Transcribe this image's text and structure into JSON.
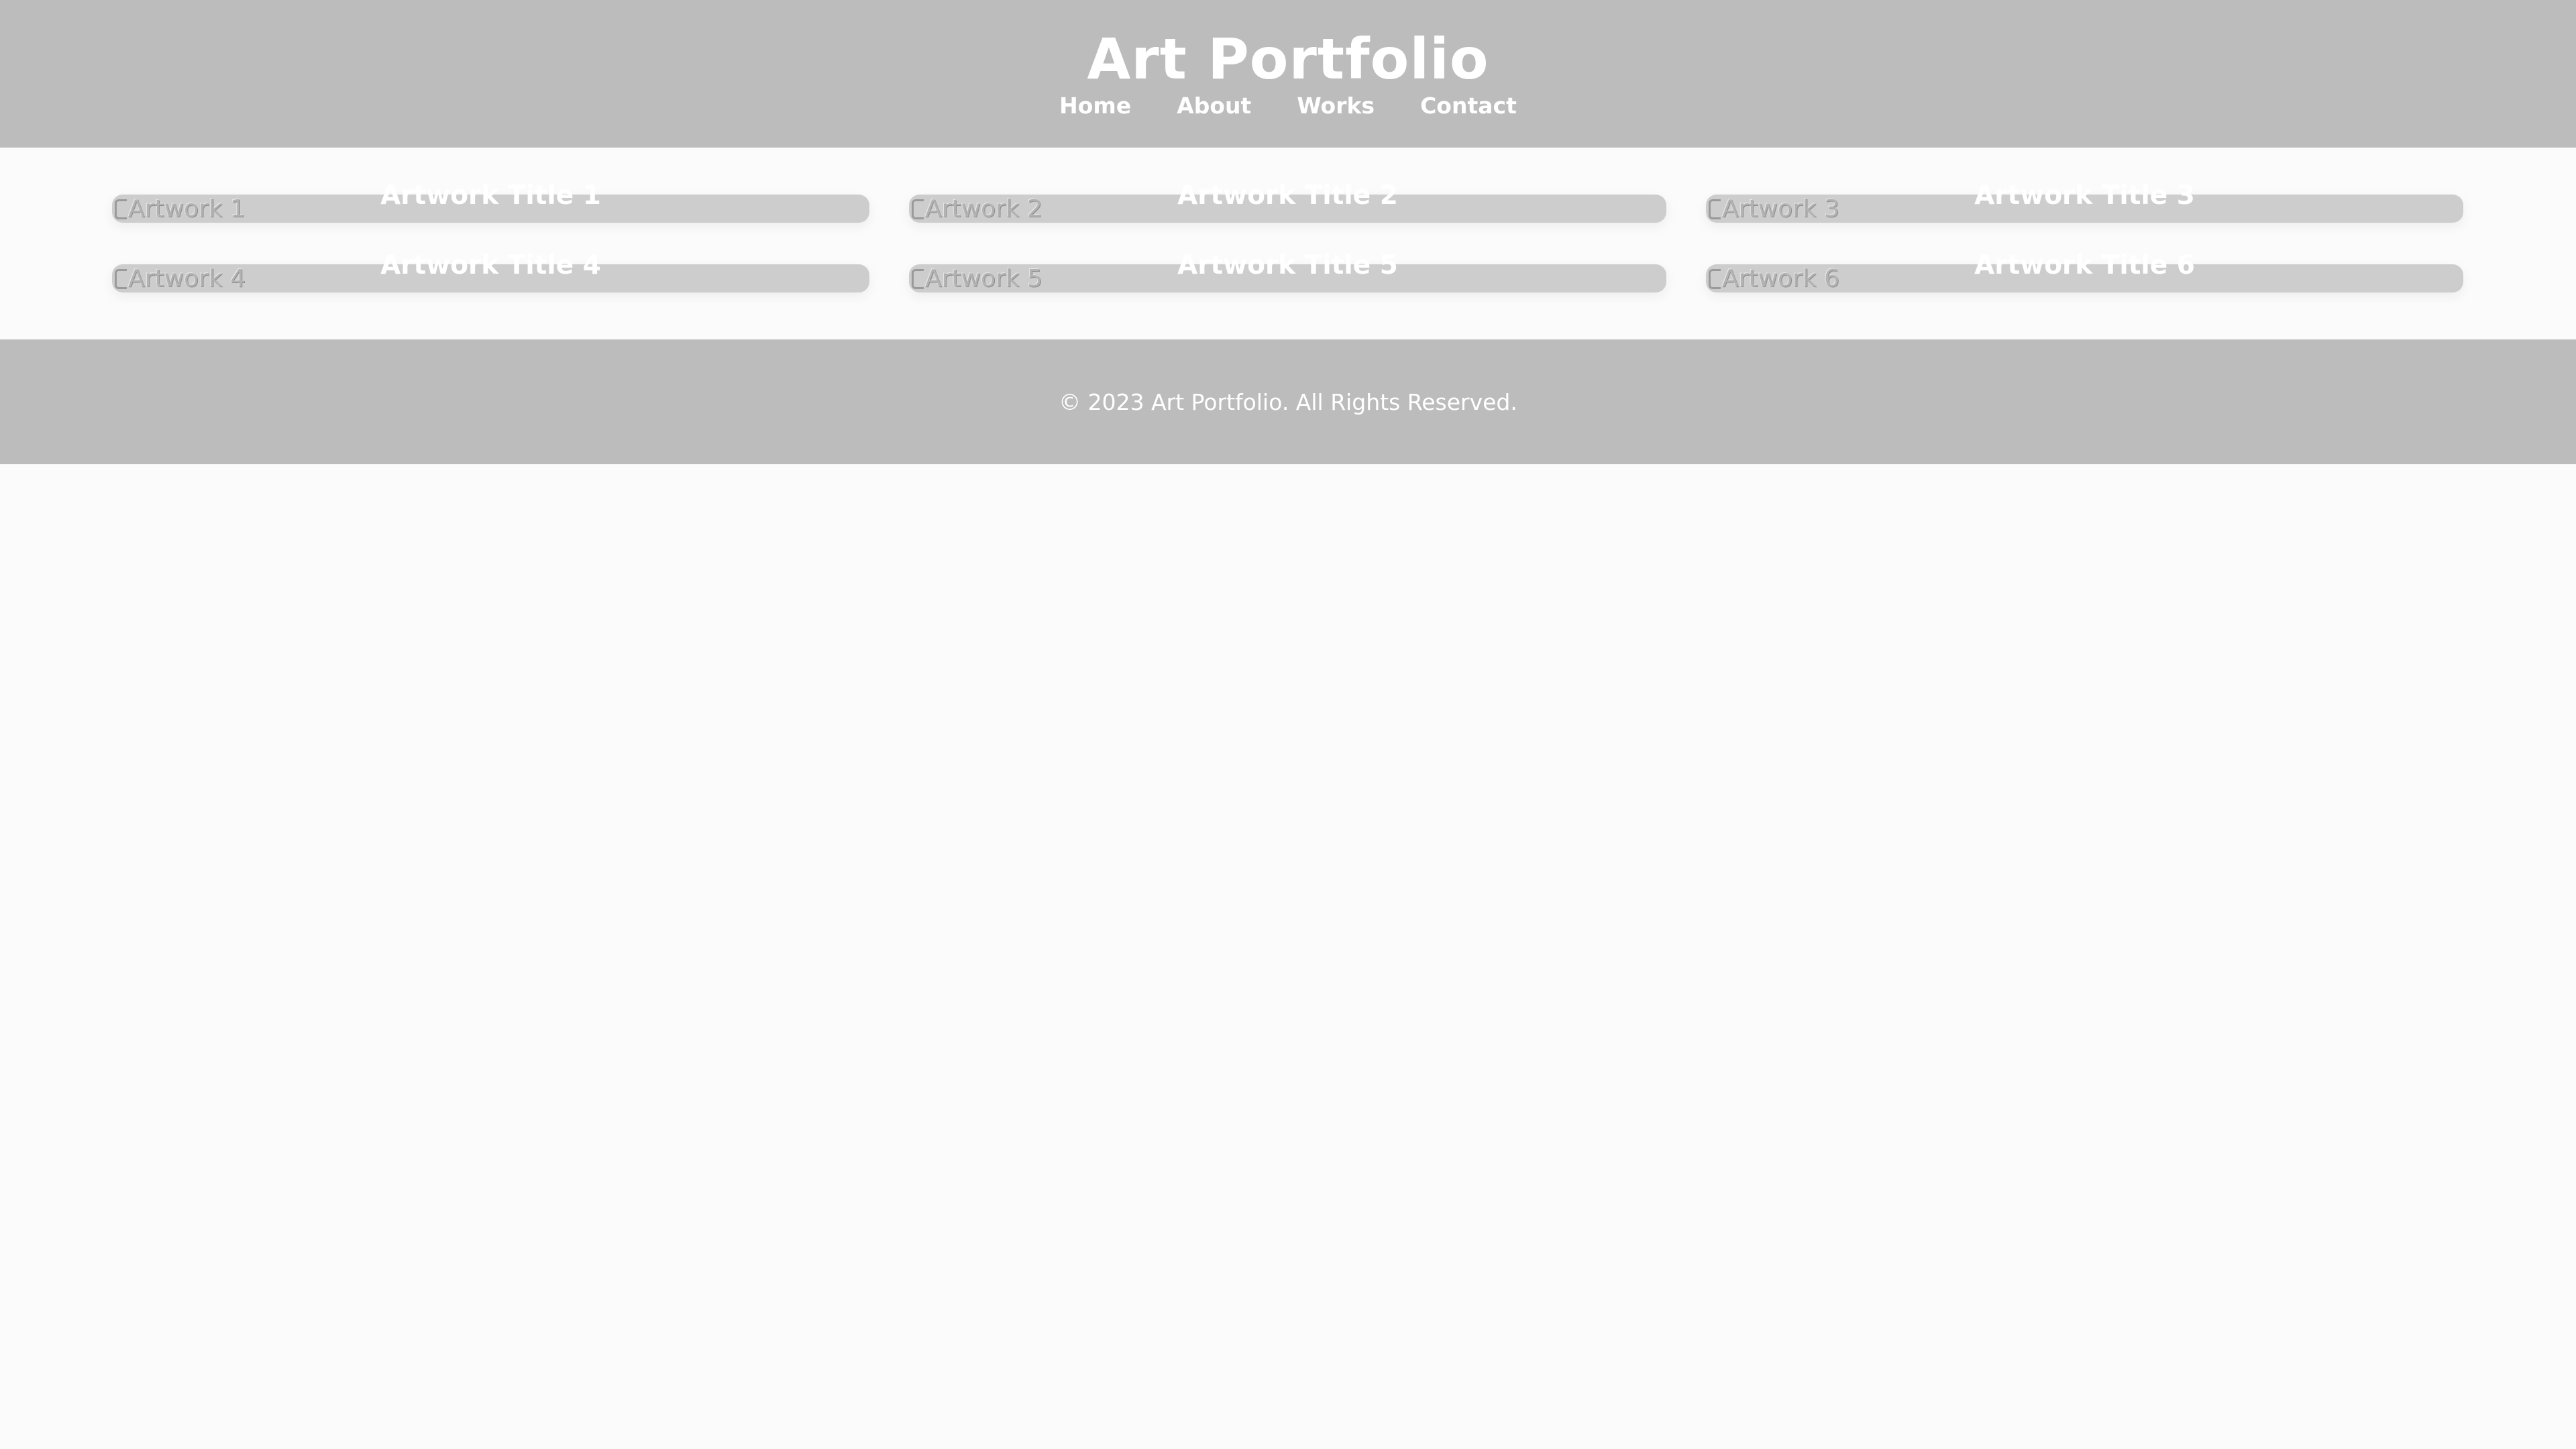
{
  "header": {
    "title": "Art Portfolio",
    "nav": [
      "Home",
      "About",
      "Works",
      "Contact"
    ]
  },
  "gallery": {
    "items": [
      {
        "alt": "Artwork 1",
        "title": "Artwork Title 1"
      },
      {
        "alt": "Artwork 2",
        "title": "Artwork Title 2"
      },
      {
        "alt": "Artwork 3",
        "title": "Artwork Title 3"
      },
      {
        "alt": "Artwork 4",
        "title": "Artwork Title 4"
      },
      {
        "alt": "Artwork 5",
        "title": "Artwork Title 5"
      },
      {
        "alt": "Artwork 6",
        "title": "Artwork Title 6"
      }
    ]
  },
  "footer": {
    "copyright": "© 2023 Art Portfolio. All Rights Reserved."
  },
  "colors": {
    "header_bg": "#bcbcbc",
    "page_bg": "#fbfbfb",
    "card_bg": "#cdcdcd",
    "text_on_header": "#ffffff"
  }
}
